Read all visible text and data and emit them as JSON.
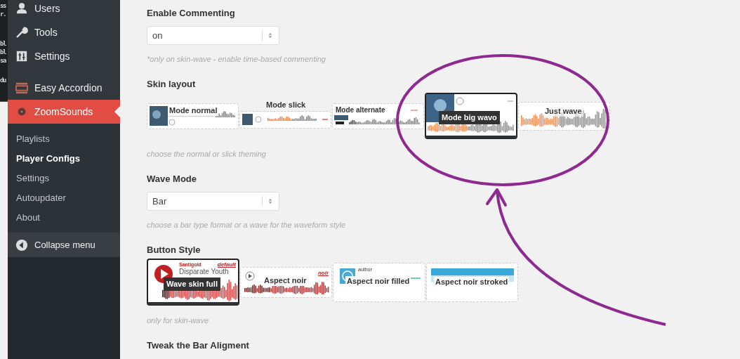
{
  "terminal": {
    "blocks": [
      [
        {
          "text": "ss"
        },
        {
          "text": "r."
        }
      ],
      [
        {
          "text": "bl"
        },
        {
          "text": "bl"
        },
        {
          "text": "sa"
        }
      ],
      [
        {
          "text": "du"
        }
      ]
    ]
  },
  "sidebar": {
    "groups": [
      {
        "items": [
          {
            "label": "Users",
            "current": false
          },
          {
            "label": "Tools",
            "current": false
          },
          {
            "label": "Settings",
            "current": false
          }
        ]
      },
      {
        "items": [
          {
            "label": "Easy Accordion",
            "current": false
          },
          {
            "label": "ZoomSounds",
            "current": true
          }
        ]
      }
    ],
    "submenu": [
      {
        "label": "Playlists",
        "selected": false
      },
      {
        "label": "Player Configs",
        "selected": true
      },
      {
        "label": "Settings",
        "selected": false
      },
      {
        "label": "Autoupdater",
        "selected": false
      },
      {
        "label": "About",
        "selected": false
      }
    ],
    "collapse": "Collapse menu"
  },
  "settings": [
    {
      "kind": "select",
      "label": "Enable Commenting",
      "value": "on",
      "hint": "*only on skin-wave - enable time-based commenting"
    },
    {
      "kind": "options",
      "label": "Skin layout",
      "hint": "choose the normal or slick theming",
      "options": [
        {
          "kind": "normal",
          "label": "Mode normal",
          "selected": false
        },
        {
          "kind": "slick",
          "label": "Mode slick",
          "selected": false
        },
        {
          "kind": "alternate",
          "label": "Mode alternate",
          "selected": false
        },
        {
          "kind": "big",
          "label": "Mode big wavo",
          "selected": true
        },
        {
          "kind": "wave",
          "label": "Just wave",
          "selected": false
        }
      ]
    },
    {
      "kind": "select",
      "label": "Wave Mode",
      "value": "Bar",
      "hint": "choose a bar type format or a wave for the waveform style"
    },
    {
      "kind": "options",
      "label": "Button Style",
      "hint": "only for skin-wave",
      "options": [
        {
          "kind": "full",
          "label": "Wave skin full",
          "selected": true,
          "artist": "Santigold",
          "song": "Disparate Youth",
          "tag": "default"
        },
        {
          "kind": "noir",
          "label": "Aspect noir",
          "selected": false,
          "tag": "noir"
        },
        {
          "kind": "filled",
          "label": "Aspect noir filled",
          "selected": false,
          "artist": "author"
        },
        {
          "kind": "stroked",
          "label": "Aspect noir stroked",
          "selected": false
        }
      ]
    },
    {
      "kind": "heading",
      "label": "Tweak the Bar Aligment"
    }
  ]
}
